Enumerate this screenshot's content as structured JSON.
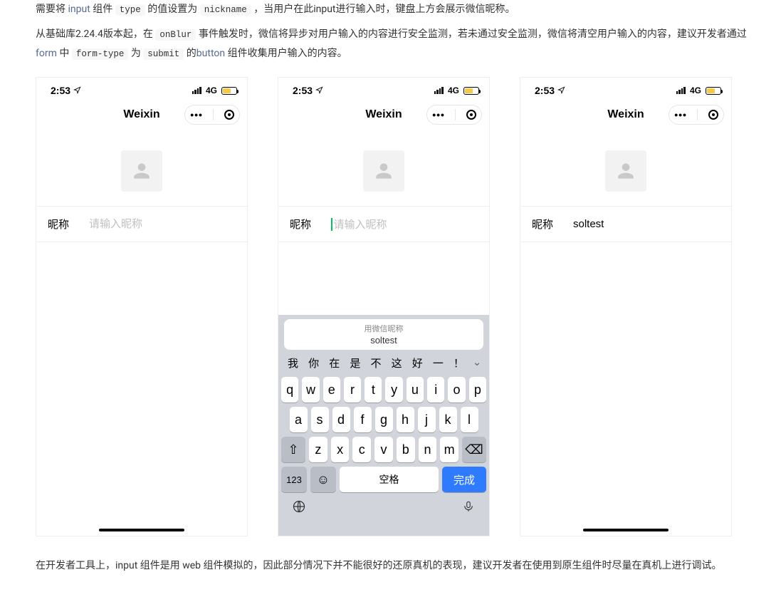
{
  "para1": {
    "t1": "需要将 ",
    "link1": "input",
    "t2": " 组件 ",
    "code1": "type",
    "t3": " 的值设置为 ",
    "code2": "nickname",
    "t4": " ，当用户在此input进行输入时，键盘上方会展示微信昵称。"
  },
  "para2": {
    "t1": "从基础库2.24.4版本起，在 ",
    "code1": "onBlur",
    "t2": " 事件触发时，微信将异步对用户输入的内容进行安全监测，若未通过安全监测，微信将清空用户输入的内容，建议开发者通过 ",
    "link1": "form",
    "t3": " 中 ",
    "code2": "form-type",
    "t4": " 为 ",
    "code3": "submit",
    "t5": " 的",
    "link2": "button",
    "t6": " 组件收集用户输入的内容。"
  },
  "status": {
    "time": "2:53",
    "net": "4G"
  },
  "nav": {
    "title": "Weixin"
  },
  "form": {
    "label": "昵称",
    "placeholder": "请输入昵称",
    "value3": "soltest"
  },
  "keyboard": {
    "suggest_label": "用微信昵称",
    "suggest_value": "soltest",
    "candidates": [
      "我",
      "你",
      "在",
      "是",
      "不",
      "这",
      "好",
      "一",
      "！"
    ],
    "row1": [
      "q",
      "w",
      "e",
      "r",
      "t",
      "y",
      "u",
      "i",
      "o",
      "p"
    ],
    "row2": [
      "a",
      "s",
      "d",
      "f",
      "g",
      "h",
      "j",
      "k",
      "l"
    ],
    "row3": [
      "z",
      "x",
      "c",
      "v",
      "b",
      "n",
      "m"
    ],
    "num": "123",
    "space": "空格",
    "done": "完成"
  },
  "para3": "在开发者工具上，input 组件是用 web 组件模拟的，因此部分情况下并不能很好的还原真机的表现，建议开发者在使用到原生组件时尽量在真机上进行调试。"
}
